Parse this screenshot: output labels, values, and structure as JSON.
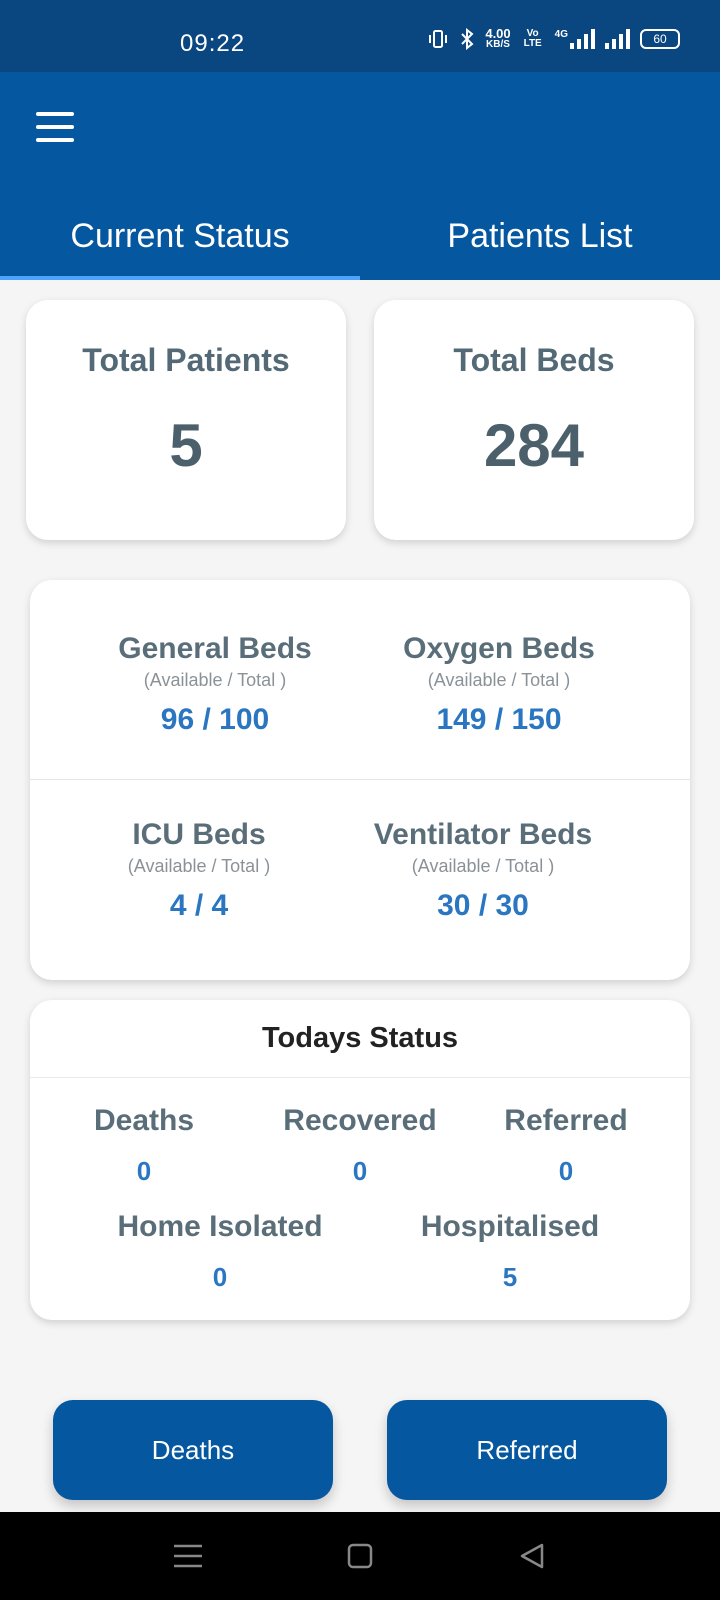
{
  "status_bar": {
    "time": "09:22",
    "net_speed": "4.00",
    "net_unit": "KB/S",
    "volte": "Vo LTE",
    "net_type": "4G",
    "battery": "60"
  },
  "tabs": [
    {
      "label": "Current Status",
      "active": true
    },
    {
      "label": "Patients List",
      "active": false
    }
  ],
  "summary": {
    "total_patients_label": "Total Patients",
    "total_patients_value": "5",
    "total_beds_label": "Total Beds",
    "total_beds_value": "284"
  },
  "beds": {
    "sub_label": "(Available / Total )",
    "general": {
      "label": "General Beds",
      "value": "96 / 100"
    },
    "oxygen": {
      "label": "Oxygen Beds",
      "value": "149 / 150"
    },
    "icu": {
      "label": "ICU Beds",
      "value": "4 / 4"
    },
    "ventilator": {
      "label": "Ventilator Beds",
      "value": "30 / 30"
    }
  },
  "todays_status": {
    "title": "Todays Status",
    "deaths": {
      "label": "Deaths",
      "value": "0"
    },
    "recovered": {
      "label": "Recovered",
      "value": "0"
    },
    "referred": {
      "label": "Referred",
      "value": "0"
    },
    "home_isolated": {
      "label": "Home Isolated",
      "value": "0"
    },
    "hospitalised": {
      "label": "Hospitalised",
      "value": "5"
    }
  },
  "actions": {
    "deaths_label": "Deaths",
    "referred_label": "Referred"
  },
  "colors": {
    "primary": "#0557a0",
    "status_bar": "#0a467f",
    "tab_indicator": "#4ea3ff",
    "value_blue": "#2a76c1",
    "label_gray": "#5a6e79"
  }
}
